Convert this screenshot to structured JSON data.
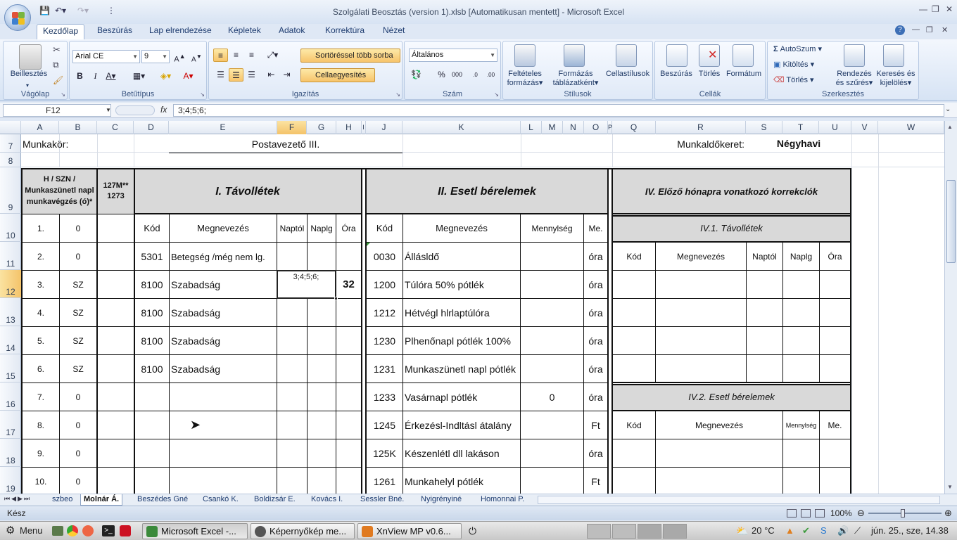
{
  "window": {
    "title": "Szolgálati Beosztás (version 1).xlsb [Automatikusan mentett] - Microsoft Excel"
  },
  "ribbon_tabs": [
    "Kezdőlap",
    "Beszúrás",
    "Lap elrendezése",
    "Képletek",
    "Adatok",
    "Korrektúra",
    "Nézet"
  ],
  "ribbon": {
    "clipboard": {
      "paste": "Beillesztés",
      "label": "Vágólap"
    },
    "font": {
      "name": "Arial CE",
      "size": "9",
      "label": "Betűtípus"
    },
    "alignment": {
      "wrap": "Sortöréssel több sorba",
      "merge": "Cellaegyesítés",
      "label": "Igazítás"
    },
    "number": {
      "format": "Általános",
      "label": "Szám"
    },
    "styles": {
      "cond1": "Feltételes",
      "cond2": "formázás",
      "table1": "Formázás",
      "table2": "táblázatként",
      "cell": "Cellastílusok",
      "label": "Stílusok"
    },
    "cells": {
      "insert": "Beszúrás",
      "delete": "Törlés",
      "format": "Formátum",
      "label": "Cellák"
    },
    "editing": {
      "autosum": "AutoSzum",
      "fill": "Kitöltés",
      "clear": "Törlés",
      "sort1": "Rendezés",
      "sort2": "és szűrés",
      "find1": "Keresés és",
      "find2": "kijelölés",
      "label": "Szerkesztés"
    }
  },
  "formula_bar": {
    "name_box": "F12",
    "fx": "fx",
    "formula": "3;4;5;6;"
  },
  "columns": [
    "A",
    "B",
    "C",
    "D",
    "E",
    "F",
    "G",
    "H",
    "I",
    "J",
    "K",
    "L",
    "M",
    "N",
    "O",
    "P",
    "Q",
    "R",
    "S",
    "T",
    "U",
    "V",
    "W"
  ],
  "rows": [
    "7",
    "8",
    "9",
    "10",
    "11",
    "12",
    "13",
    "14",
    "15",
    "16",
    "17",
    "18",
    "19"
  ],
  "sheet": {
    "munkakor_label": "Munkakör:",
    "munkakor_value": "Postavezető III.",
    "keret_label": "Munkaldőkeret:",
    "keret_value": "Négyhavi",
    "hdr_a": "H / SZN / Munkaszünetl napl munkavégzés (ó)*",
    "hdr_c": "127M** 1273",
    "sec1": "I. Távollétek",
    "sec2": "II. Esetl bérelemek",
    "sec4": "IV. Előző hónapra vonatkozó korrekclók",
    "sec41": "IV.1. Távollétek",
    "sec42": "IV.2. Esetl bérelemek",
    "s1_cols": [
      "Kód",
      "Megnevezés",
      "Naptól",
      "Naplg",
      "Óra"
    ],
    "s2_cols": [
      "Kód",
      "Megnevezés",
      "Mennylség",
      "Me."
    ],
    "s41_cols": [
      "Kód",
      "Megnevezés",
      "Naptól",
      "Naplg",
      "Óra"
    ],
    "s42_cols": [
      "Kód",
      "Megnevezés",
      "Mennylség",
      "Me."
    ],
    "days": [
      {
        "n": "1.",
        "b": "0"
      },
      {
        "n": "2.",
        "b": "0"
      },
      {
        "n": "3.",
        "b": "SZ"
      },
      {
        "n": "4.",
        "b": "SZ"
      },
      {
        "n": "5.",
        "b": "SZ"
      },
      {
        "n": "6.",
        "b": "SZ"
      },
      {
        "n": "7.",
        "b": "0"
      },
      {
        "n": "8.",
        "b": "0"
      },
      {
        "n": "9.",
        "b": "0"
      },
      {
        "n": "10.",
        "b": "0"
      }
    ],
    "absences": [
      {
        "code": "5301",
        "name": "Betegség /még nem lg."
      },
      {
        "code": "8100",
        "name": "Szabadság"
      },
      {
        "code": "8100",
        "name": "Szabadság"
      },
      {
        "code": "8100",
        "name": "Szabadság"
      },
      {
        "code": "8100",
        "name": "Szabadság"
      }
    ],
    "active_cell_value": "3;4;5;6;",
    "hours_value": "32",
    "wage_items": [
      {
        "code": "0030",
        "name": "Állásldő",
        "qty": "",
        "unit": "óra"
      },
      {
        "code": "1200",
        "name": "Túlóra 50% pótlék",
        "qty": "",
        "unit": "óra"
      },
      {
        "code": "1212",
        "name": "Hétvégl hlrlaptúlóra",
        "qty": "",
        "unit": "óra"
      },
      {
        "code": "1230",
        "name": "Plhenőnapl pótlék 100%",
        "qty": "",
        "unit": "óra"
      },
      {
        "code": "1231",
        "name": "Munkaszünetl napl pótlék",
        "qty": "",
        "unit": "óra"
      },
      {
        "code": "1233",
        "name": "Vasárnapl pótlék",
        "qty": "0",
        "unit": "óra"
      },
      {
        "code": "1245",
        "name": "Érkezésl-Indltásl átalány",
        "qty": "",
        "unit": "Ft"
      },
      {
        "code": "125K",
        "name": "Készenlétl dll lakáson",
        "qty": "",
        "unit": "óra"
      },
      {
        "code": "1261",
        "name": "Munkahelyl pótlék",
        "qty": "",
        "unit": "Ft"
      }
    ]
  },
  "sheet_tabs": [
    "szbeo",
    "Molnár Á.",
    "Beszédes Gné",
    "Csankó K.",
    "Boldizsár E.",
    "Kovács I.",
    "Sessler Bné.",
    "Nyigrényiné",
    "Homonnai P."
  ],
  "status": {
    "ready": "Kész",
    "zoom": "100%"
  },
  "taskbar": {
    "menu": "Menu",
    "items": [
      "Microsoft Excel -...",
      "Képernyőkép me...",
      "XnView MP v0.6..."
    ],
    "temp": "20 °C",
    "clock": "jún. 25., sze, 14.38"
  }
}
